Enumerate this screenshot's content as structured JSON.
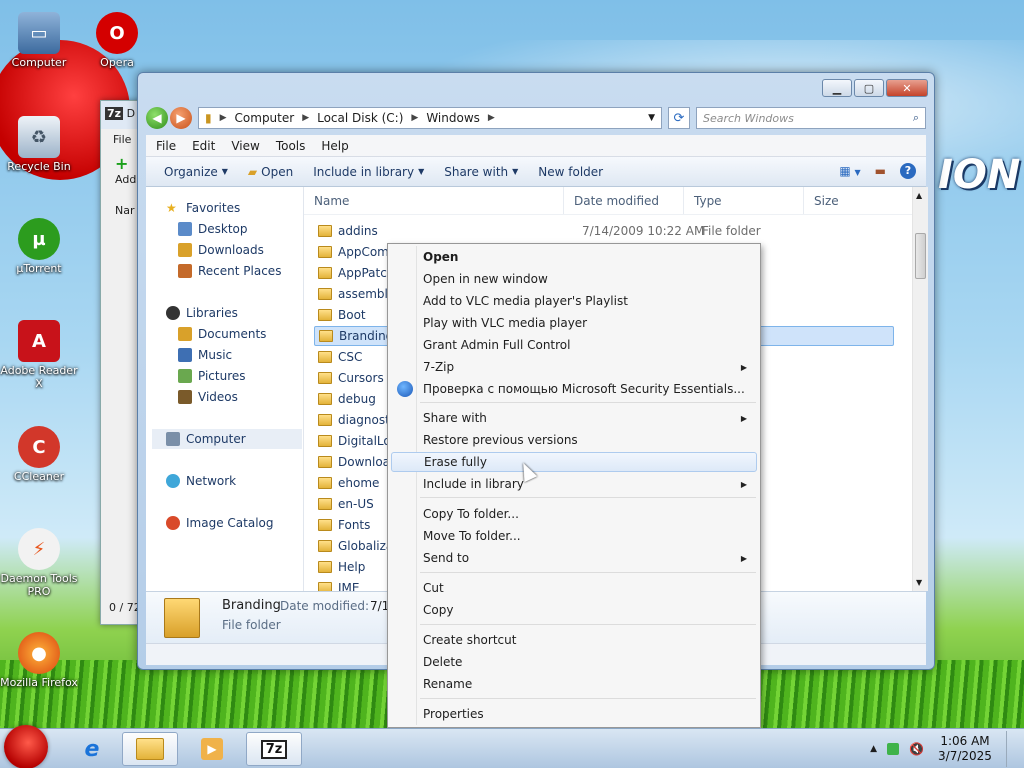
{
  "desktop": {
    "icons": [
      {
        "label": "Computer"
      },
      {
        "label": "Opera"
      },
      {
        "label": "Recycle Bin"
      },
      {
        "label": "µTorrent"
      },
      {
        "label": "Adobe Reader X"
      },
      {
        "label": "CCleaner"
      },
      {
        "label": "Daemon Tools PRO"
      },
      {
        "label": "Mozilla Firefox"
      }
    ],
    "wallpaper_text": "ION"
  },
  "window_7z": {
    "title_short": "D",
    "menu_short": "File",
    "toolbar_short": "Add",
    "col_short": "Nar",
    "status_short": "0 / 72"
  },
  "explorer": {
    "address": {
      "segments": [
        "Computer",
        "Local Disk (C:)",
        "Windows"
      ]
    },
    "search_placeholder": "Search Windows",
    "menubar": [
      "File",
      "Edit",
      "View",
      "Tools",
      "Help"
    ],
    "commands": {
      "organize": "Organize",
      "open": "Open",
      "include": "Include in library",
      "share": "Share with",
      "new_folder": "New folder"
    },
    "nav": {
      "favorites": "Favorites",
      "desktop": "Desktop",
      "downloads": "Downloads",
      "recent": "Recent Places",
      "libraries": "Libraries",
      "documents": "Documents",
      "music": "Music",
      "pictures": "Pictures",
      "videos": "Videos",
      "computer": "Computer",
      "network": "Network",
      "image_catalog": "Image Catalog"
    },
    "columns": {
      "name": "Name",
      "date": "Date modified",
      "type": "Type",
      "size": "Size"
    },
    "files": [
      {
        "name": "addins",
        "date": "7/14/2009 10:22 AM",
        "type": "File folder"
      },
      {
        "name": "AppCompat"
      },
      {
        "name": "AppPatch"
      },
      {
        "name": "assembly"
      },
      {
        "name": "Boot"
      },
      {
        "name": "Branding"
      },
      {
        "name": "CSC"
      },
      {
        "name": "Cursors"
      },
      {
        "name": "debug"
      },
      {
        "name": "diagnostics"
      },
      {
        "name": "DigitalLocker"
      },
      {
        "name": "Downloaded"
      },
      {
        "name": "ehome"
      },
      {
        "name": "en-US"
      },
      {
        "name": "Fonts"
      },
      {
        "name": "Globalization"
      },
      {
        "name": "Help"
      },
      {
        "name": "IME"
      }
    ],
    "details": {
      "name": "Branding",
      "date_label": "Date modified:",
      "date_value": "7/14...",
      "type": "File folder"
    }
  },
  "context_menu": {
    "items": {
      "open": "Open",
      "open_new": "Open in new window",
      "vlc_add": "Add to VLC media player's Playlist",
      "vlc_play": "Play with VLC media player",
      "grant": "Grant Admin Full Control",
      "zip": "7-Zip",
      "mse": "Проверка с помощью Microsoft Security Essentials...",
      "share": "Share with",
      "restore": "Restore previous versions",
      "erase": "Erase fully",
      "include": "Include in library",
      "copy_to": "Copy To folder...",
      "move_to": "Move To folder...",
      "send_to": "Send to",
      "cut": "Cut",
      "copy": "Copy",
      "shortcut": "Create shortcut",
      "delete": "Delete",
      "rename": "Rename",
      "properties": "Properties"
    }
  },
  "taskbar": {
    "time": "1:06 AM",
    "date": "3/7/2025",
    "seven_zip": "7z"
  },
  "colors": {
    "accent": "#2a6ac0",
    "selection": "#cfe3fa",
    "menu_highlight": "#dde9f8"
  }
}
